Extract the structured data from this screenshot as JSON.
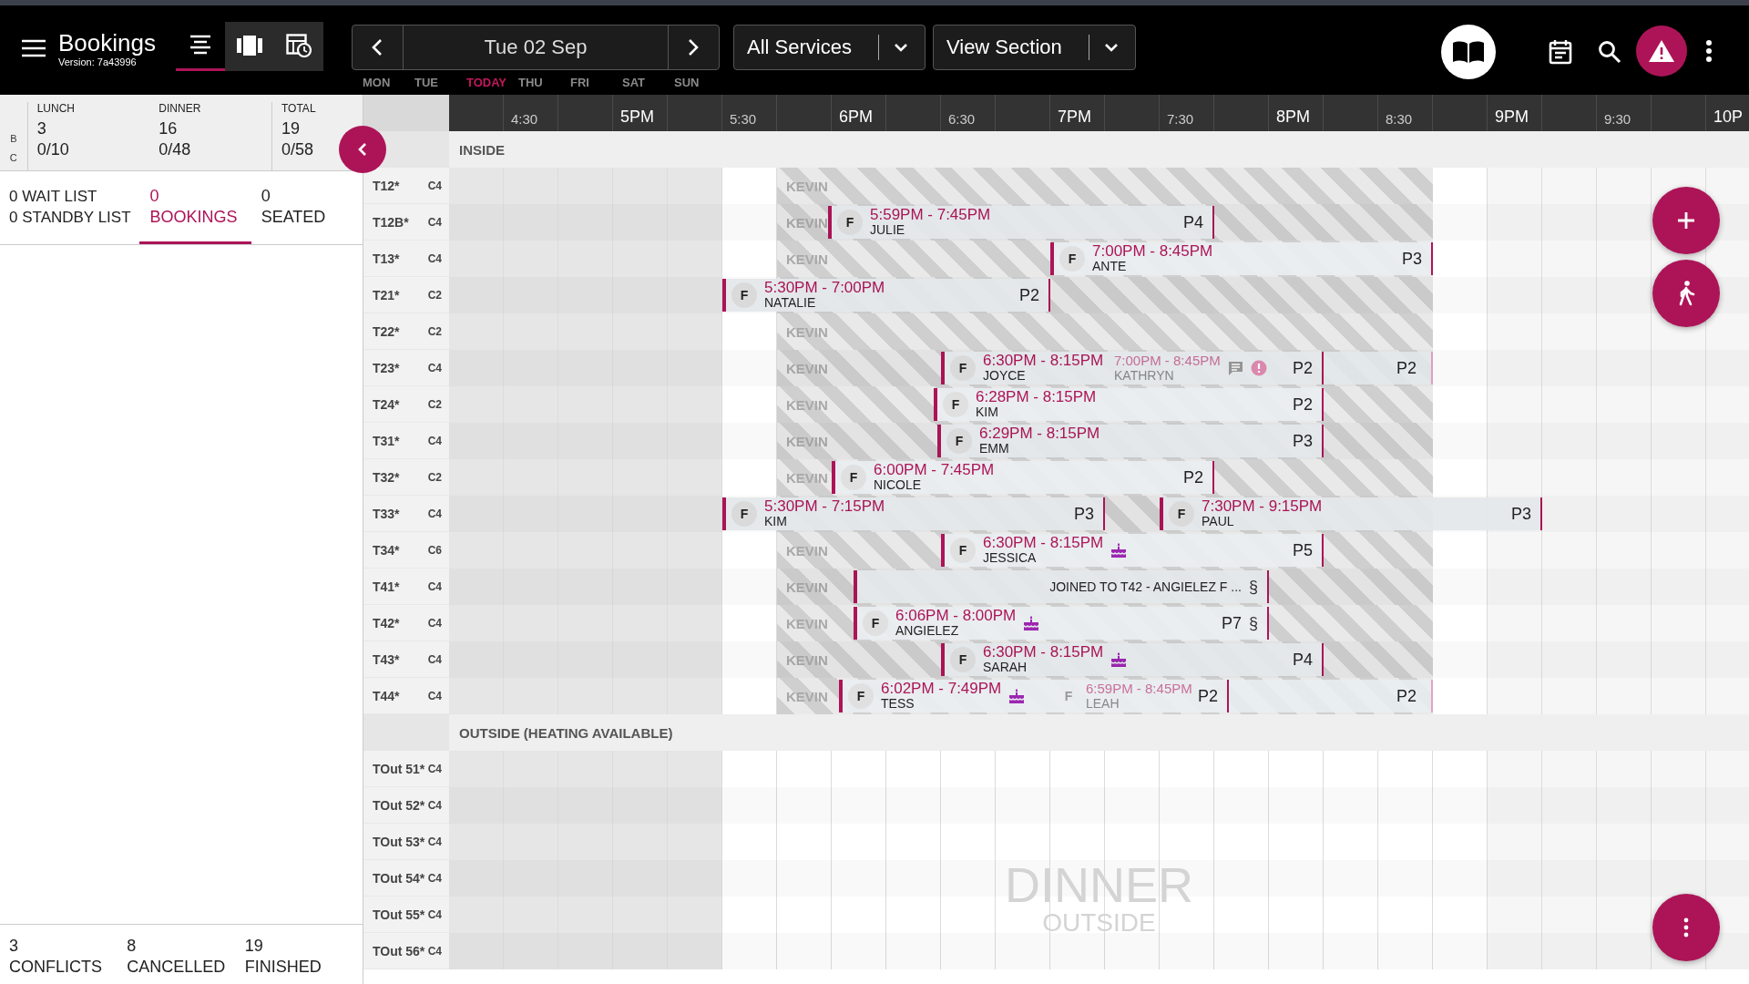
{
  "app": {
    "title": "Bookings",
    "version": "Version: 7a43996"
  },
  "view_modes": [
    {
      "kind": "list",
      "selected": true
    },
    {
      "kind": "columns",
      "selected": false
    },
    {
      "kind": "schedule",
      "selected": false
    }
  ],
  "date_nav": {
    "date": "Tue 02 Sep"
  },
  "weekdays": [
    {
      "label": "MON",
      "today": false
    },
    {
      "label": "TUE",
      "today": false
    },
    {
      "label": "TODAY",
      "today": true
    },
    {
      "label": "THU",
      "today": false
    },
    {
      "label": "FRI",
      "today": false
    },
    {
      "label": "SAT",
      "today": false
    },
    {
      "label": "SUN",
      "today": false
    }
  ],
  "service_filter": "All Services",
  "section_filter": "View Section",
  "summary": {
    "row_labels": [
      "B",
      "C"
    ],
    "columns": [
      {
        "label": "LUNCH",
        "values": [
          "3",
          "0/10"
        ]
      },
      {
        "label": "DINNER",
        "values": [
          "16",
          "0/48"
        ]
      },
      {
        "label": "TOTAL",
        "values": [
          "19",
          "0/58"
        ]
      }
    ]
  },
  "tabs": [
    {
      "kind": "stacked",
      "lines": [
        "0 WAIT LIST",
        "0 STANDBY LIST"
      ],
      "selected": false
    },
    {
      "kind": "count",
      "count": "0",
      "label": "BOOKINGS",
      "selected": true
    },
    {
      "kind": "count",
      "count": "0",
      "label": "SEATED",
      "selected": false
    }
  ],
  "footer_counts": [
    {
      "count": "3",
      "label": "CONFLICTS"
    },
    {
      "count": "8",
      "label": "CANCELLED"
    },
    {
      "count": "19",
      "label": "FINISHED"
    }
  ],
  "timeline": {
    "ticks": [
      {
        "label": "4:30",
        "kind": "half"
      },
      {
        "label": "5PM",
        "kind": "hour"
      },
      {
        "label": "5:30",
        "kind": "half"
      },
      {
        "label": "6PM",
        "kind": "hour"
      },
      {
        "label": "6:30",
        "kind": "half"
      },
      {
        "label": "7PM",
        "kind": "hour"
      },
      {
        "label": "7:30",
        "kind": "half"
      },
      {
        "label": "8PM",
        "kind": "hour"
      },
      {
        "label": "8:30",
        "kind": "half"
      },
      {
        "label": "9PM",
        "kind": "hour"
      },
      {
        "label": "9:30",
        "kind": "half"
      },
      {
        "label": "10P",
        "kind": "hour"
      }
    ]
  },
  "sections": [
    {
      "name": "INSIDE",
      "tables": [
        {
          "name": "T12*",
          "covers": "C4",
          "blocked": true,
          "block_label": "KEVIN"
        },
        {
          "name": "T12B*",
          "covers": "C4",
          "blocked": true,
          "block_label": "KEVIN",
          "bookings": [
            {
              "kind": "booking",
              "status": "F",
              "time": "5:59PM - 7:45PM",
              "name": "JULIE",
              "party": "P4",
              "faded": false
            }
          ]
        },
        {
          "name": "T13*",
          "covers": "C4",
          "blocked": true,
          "block_label": "KEVIN",
          "bookings": [
            {
              "kind": "booking",
              "status": "F",
              "time": "7:00PM - 8:45PM",
              "name": "ANTE",
              "party": "P3",
              "faded": false
            }
          ]
        },
        {
          "name": "T21*",
          "covers": "C2",
          "blocked": true,
          "bookings": [
            {
              "kind": "booking",
              "status": "F",
              "time": "5:30PM - 7:00PM",
              "name": "NATALIE",
              "party": "P2",
              "faded": false
            }
          ]
        },
        {
          "name": "T22*",
          "covers": "C2",
          "blocked": true,
          "block_label": "KEVIN"
        },
        {
          "name": "T23*",
          "covers": "C4",
          "blocked": true,
          "block_label": "KEVIN",
          "bookings": [
            {
              "kind": "booking",
              "status": "F",
              "time": "6:30PM - 8:15PM",
              "name": "JOYCE",
              "party": "P2",
              "faded": false
            },
            {
              "kind": "booking",
              "time": "7:00PM - 8:45PM",
              "name": "KATHRYN",
              "party": "P2",
              "faded": true,
              "note": true,
              "alert": true
            }
          ]
        },
        {
          "name": "T24*",
          "covers": "C2",
          "blocked": true,
          "block_label": "KEVIN",
          "bookings": [
            {
              "kind": "booking",
              "status": "F",
              "time": "6:28PM - 8:15PM",
              "name": "KIM",
              "party": "P2",
              "faded": false
            }
          ]
        },
        {
          "name": "T31*",
          "covers": "C4",
          "blocked": true,
          "block_label": "KEVIN",
          "bookings": [
            {
              "kind": "booking",
              "status": "F",
              "time": "6:29PM - 8:15PM",
              "name": "EMM",
              "party": "P3",
              "faded": false
            }
          ]
        },
        {
          "name": "T32*",
          "covers": "C2",
          "blocked": true,
          "block_label": "KEVIN",
          "bookings": [
            {
              "kind": "booking",
              "status": "F",
              "time": "6:00PM - 7:45PM",
              "name": "NICOLE",
              "party": "P2",
              "faded": false
            }
          ]
        },
        {
          "name": "T33*",
          "covers": "C4",
          "blocked": true,
          "bookings": [
            {
              "kind": "booking",
              "status": "F",
              "time": "5:30PM - 7:15PM",
              "name": "KIM",
              "party": "P3",
              "faded": false
            },
            {
              "kind": "booking",
              "status": "F",
              "time": "7:30PM - 9:15PM",
              "name": "PAUL",
              "party": "P3",
              "faded": false
            }
          ]
        },
        {
          "name": "T34*",
          "covers": "C6",
          "blocked": true,
          "block_label": "KEVIN",
          "bookings": [
            {
              "kind": "booking",
              "status": "F",
              "time": "6:30PM - 8:15PM",
              "name": "JESSICA",
              "party": "P5",
              "faded": false,
              "cake": true
            }
          ]
        },
        {
          "name": "T41*",
          "covers": "C4",
          "blocked": true,
          "block_label": "KEVIN",
          "bookings": [
            {
              "kind": "joined",
              "text": "JOINED TO T42 - ANGIELEZ F ...",
              "link_mark": "§"
            }
          ]
        },
        {
          "name": "T42*",
          "covers": "C4",
          "blocked": true,
          "block_label": "KEVIN",
          "bookings": [
            {
              "kind": "booking",
              "status": "F",
              "time": "6:06PM - 8:00PM",
              "name": "ANGIELEZ",
              "party": "P7",
              "link_mark": "§",
              "faded": false,
              "cake": true
            }
          ]
        },
        {
          "name": "T43*",
          "covers": "C4",
          "blocked": true,
          "block_label": "KEVIN",
          "bookings": [
            {
              "kind": "booking",
              "status": "F",
              "time": "6:30PM - 8:15PM",
              "name": "SARAH",
              "party": "P4",
              "faded": false,
              "cake": true
            }
          ]
        },
        {
          "name": "T44*",
          "covers": "C4",
          "blocked": true,
          "block_label": "KEVIN",
          "bookings": [
            {
              "kind": "booking",
              "status": "F",
              "time": "6:02PM - 7:49PM",
              "name": "TESS",
              "party": "P2",
              "faded": false,
              "cake": true
            },
            {
              "kind": "booking",
              "status": "F",
              "time": "6:59PM - 8:45PM",
              "name": "LEAH",
              "party": "P2",
              "faded": true
            }
          ]
        }
      ]
    },
    {
      "name": "OUTSIDE (HEATING AVAILABLE)",
      "background_title": "DINNER",
      "background_subtitle": "OUTSIDE",
      "tables": [
        {
          "name": "TOut 51*",
          "covers": "C4",
          "blocked": false
        },
        {
          "name": "TOut 52*",
          "covers": "C4",
          "blocked": false
        },
        {
          "name": "TOut 53*",
          "covers": "C4",
          "blocked": false
        },
        {
          "name": "TOut 54*",
          "covers": "C4",
          "blocked": false
        },
        {
          "name": "TOut 55*",
          "covers": "C4",
          "blocked": false
        },
        {
          "name": "TOut 56*",
          "covers": "C4",
          "blocked": false
        }
      ]
    }
  ]
}
